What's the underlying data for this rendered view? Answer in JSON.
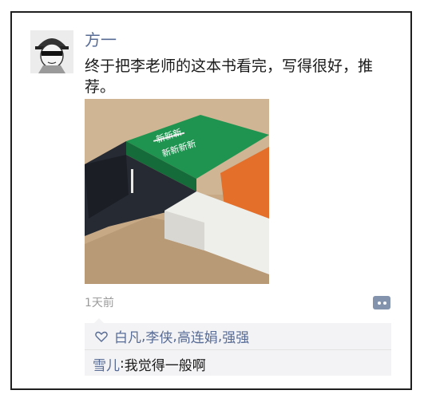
{
  "post": {
    "username": "方一",
    "text": "终于把李老师的这本书看完，写得很好，推荐。",
    "time": "1天前"
  },
  "photo": {
    "green_book_title_line1": "新新新",
    "green_book_title_line2": "新新新新"
  },
  "likes": {
    "names": [
      "白凡",
      "李侠",
      "高连娟",
      "强强"
    ],
    "separator": ", "
  },
  "comment": {
    "author": "雪儿",
    "colon": ": ",
    "text": "我觉得一般啊"
  },
  "colors": {
    "link_blue": "#576b95",
    "panel_bg": "#f3f3f5",
    "more_button": "#8392ad"
  }
}
